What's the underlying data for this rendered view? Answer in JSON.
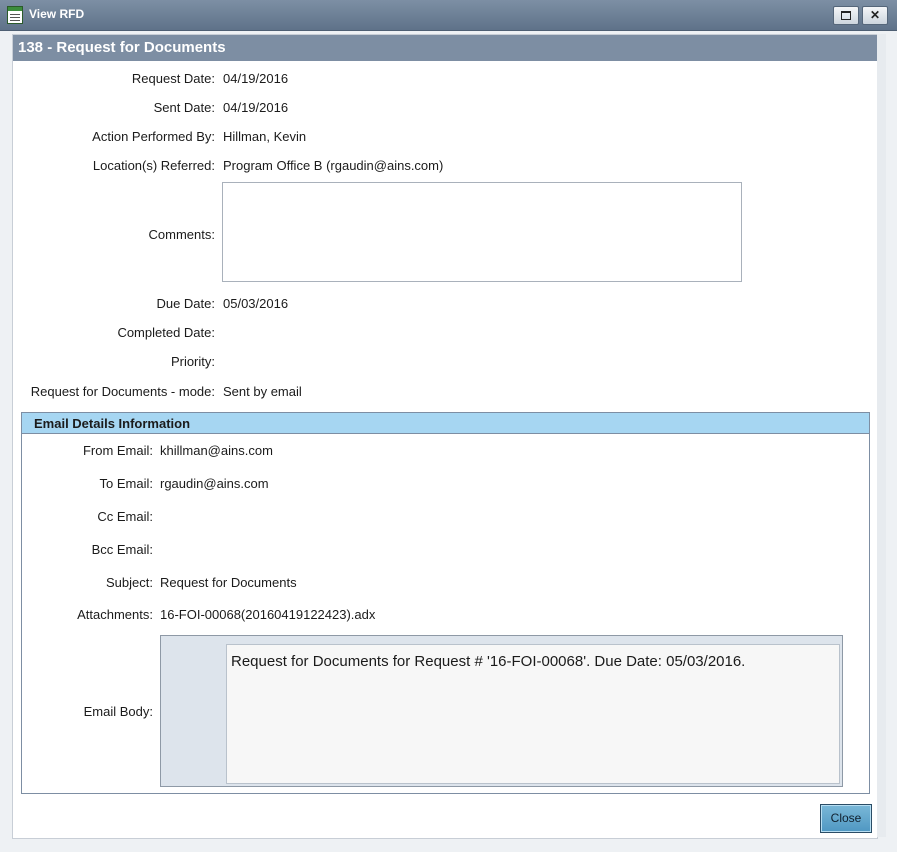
{
  "window": {
    "title": "View RFD"
  },
  "panel": {
    "header": "138 - Request for Documents"
  },
  "fields": {
    "request_date": {
      "label": "Request Date:",
      "value": "04/19/2016"
    },
    "sent_date": {
      "label": "Sent Date:",
      "value": "04/19/2016"
    },
    "action_performed_by": {
      "label": "Action Performed By:",
      "value": "Hillman, Kevin"
    },
    "locations_referred": {
      "label": "Location(s) Referred:",
      "value": "Program Office B (rgaudin@ains.com)"
    },
    "comments": {
      "label": "Comments:",
      "value": ""
    },
    "due_date": {
      "label": "Due Date:",
      "value": "05/03/2016"
    },
    "completed_date": {
      "label": "Completed Date:",
      "value": ""
    },
    "priority": {
      "label": "Priority:",
      "value": ""
    },
    "mode": {
      "label": "Request for Documents - mode:",
      "value": "Sent by email"
    }
  },
  "email": {
    "header": "Email Details Information",
    "from": {
      "label": "From Email:",
      "value": "khillman@ains.com"
    },
    "to": {
      "label": "To Email:",
      "value": "rgaudin@ains.com"
    },
    "cc": {
      "label": "Cc Email:",
      "value": ""
    },
    "bcc": {
      "label": "Bcc Email:",
      "value": ""
    },
    "subject": {
      "label": "Subject:",
      "value": "Request for Documents"
    },
    "attachments": {
      "label": "Attachments:",
      "value": "16-FOI-00068(20160419122423).adx"
    },
    "body": {
      "label": "Email Body:",
      "value": "Request for Documents for Request # '16-FOI-00068'. Due Date: 05/03/2016."
    }
  },
  "buttons": {
    "close": "Close"
  },
  "colors": {
    "title_bar": "#6e8096",
    "panel_header": "#7d8ea3",
    "email_header": "#a6d6f2",
    "close_button": "#5fa4cb"
  }
}
